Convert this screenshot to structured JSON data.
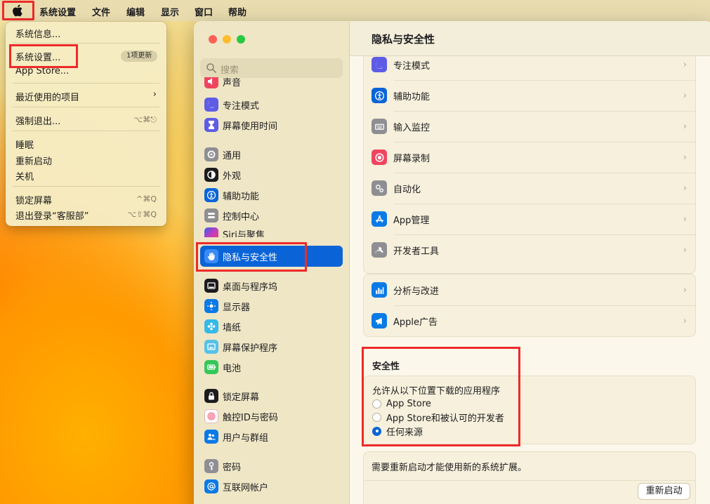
{
  "menubar": {
    "items": [
      "系统设置",
      "文件",
      "编辑",
      "显示",
      "窗口",
      "帮助"
    ]
  },
  "apple_menu": {
    "items": [
      {
        "label": "系统信息..."
      },
      {
        "label": "系统设置...",
        "badge": "1项更新"
      },
      {
        "label": "App Store..."
      },
      {
        "label": "最近使用的项目",
        "submenu": "›"
      },
      {
        "label": "强制退出...",
        "shortcut": "⌥⌘⎋"
      },
      {
        "label": "睡眠"
      },
      {
        "label": "重新启动"
      },
      {
        "label": "关机"
      },
      {
        "label": "锁定屏幕",
        "shortcut": "^⌘Q"
      },
      {
        "label": "退出登录“客服部”",
        "shortcut": "⌥⇧⌘Q"
      }
    ]
  },
  "window": {
    "search_placeholder": "搜索",
    "sidebar": [
      {
        "label": "声音",
        "icon": "sound-icon",
        "color": "#f0445f"
      },
      {
        "label": "专注模式",
        "icon": "moon-icon",
        "color": "#5e5ce6"
      },
      {
        "label": "屏幕使用时间",
        "icon": "hourglass-icon",
        "color": "#5e5ce6"
      },
      {
        "label": "通用",
        "icon": "gear-icon",
        "color": "#8e8e93"
      },
      {
        "label": "外观",
        "icon": "appearance-icon",
        "color": "#1c1c1e"
      },
      {
        "label": "辅助功能",
        "icon": "accessibility-icon",
        "color": "#0a64d8"
      },
      {
        "label": "控制中心",
        "icon": "control-center-icon",
        "color": "#8e8e93"
      },
      {
        "label": "Siri与聚焦",
        "icon": "siri-icon",
        "color": "#c23cbf"
      },
      {
        "label": "隐私与安全性",
        "icon": "hand-icon",
        "color": "#3a8bf5"
      },
      {
        "label": "桌面与程序坞",
        "icon": "dock-icon",
        "color": "#1c1c1e"
      },
      {
        "label": "显示器",
        "icon": "display-icon",
        "color": "#0a7ae6"
      },
      {
        "label": "墙纸",
        "icon": "wallpaper-icon",
        "color": "#35b9e9"
      },
      {
        "label": "屏幕保护程序",
        "icon": "screensaver-icon",
        "color": "#55c2e8"
      },
      {
        "label": "电池",
        "icon": "battery-icon",
        "color": "#34c759"
      },
      {
        "label": "锁定屏幕",
        "icon": "lock-icon",
        "color": "#1c1c1e"
      },
      {
        "label": "触控ID与密码",
        "icon": "fingerprint-icon",
        "color": "#f0677f"
      },
      {
        "label": "用户与群组",
        "icon": "users-icon",
        "color": "#0a7ae6"
      },
      {
        "label": "密码",
        "icon": "key-icon",
        "color": "#8e8e93"
      },
      {
        "label": "互联网帐户",
        "icon": "at-icon",
        "color": "#0a7ae6"
      }
    ],
    "title": "隐私与安全性",
    "group1": [
      {
        "label": "专注模式",
        "icon": "moon-icon",
        "color": "#5e5ce6"
      },
      {
        "label": "辅助功能",
        "icon": "accessibility-icon",
        "color": "#0a64d8"
      },
      {
        "label": "输入监控",
        "icon": "keyboard-icon",
        "color": "#8e8e93"
      },
      {
        "label": "屏幕录制",
        "icon": "record-icon",
        "color": "#f0445f"
      },
      {
        "label": "自动化",
        "icon": "automation-icon",
        "color": "#8e8e93"
      },
      {
        "label": "App管理",
        "icon": "appstore-icon",
        "color": "#0a7ae6"
      },
      {
        "label": "开发者工具",
        "icon": "hammer-icon",
        "color": "#8e8e93"
      }
    ],
    "group2": [
      {
        "label": "分析与改进",
        "icon": "analytics-icon",
        "color": "#0a7ae6"
      },
      {
        "label": "Apple广告",
        "icon": "megaphone-icon",
        "color": "#0a7ae6"
      }
    ],
    "security": {
      "title": "安全性",
      "label": "允许从以下位置下载的应用程序",
      "options": [
        "App Store",
        "App Store和被认可的开发者",
        "任何来源"
      ],
      "selected_index": 2
    },
    "extension_note": "需要重新启动才能使用新的系统扩展。",
    "restart_button": "重新启动"
  }
}
